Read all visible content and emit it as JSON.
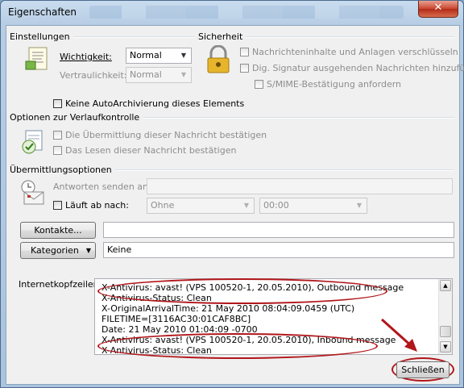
{
  "window": {
    "title": "Eigenschaften",
    "close_glyph": "✕"
  },
  "settings": {
    "heading": "Einstellungen",
    "importance_label": "Wichtigkeit:",
    "importance_value": "Normal",
    "confidentiality_label": "Vertraulichkeit:",
    "confidentiality_value": "Normal",
    "no_autoarchive_label": "Keine AutoArchivierung dieses Elements"
  },
  "security": {
    "heading": "Sicherheit",
    "encrypt_label": "Nachrichteninhalte und Anlagen verschlüsseln",
    "sign_label": "Dig. Signatur ausgehenden Nachrichten hinzufügen",
    "smime_label": "S/MIME-Bestätigung anfordern"
  },
  "tracking": {
    "heading": "Optionen zur Verlaufkontrolle",
    "delivery_label": "Die Übermittlung dieser Nachricht bestätigen",
    "read_label": "Das Lesen dieser Nachricht bestätigen"
  },
  "delivery": {
    "heading": "Übermittlungsoptionen",
    "reply_to_label": "Antworten senden an:",
    "expires_label": "Läuft ab nach:",
    "expires_date": "Ohne",
    "expires_time": "00:00"
  },
  "contacts": {
    "button_label": "Kontakte...",
    "value": ""
  },
  "categories": {
    "button_label": "Kategorien",
    "value": "Keine"
  },
  "internet_headers": {
    "label": "Internetkopfzeilen:",
    "lines": [
      "X-Antivirus: avast! (VPS 100520-1, 20.05.2010), Outbound message",
      "X-Antivirus-Status: Clean",
      "X-OriginalArrivalTime: 21 May 2010 08:04:09.0459 (UTC)",
      "FILETIME=[3116AC30:01CAF8BC]",
      "Date: 21 May 2010 01:04:09 -0700",
      "X-Antivirus: avast! (VPS 100520-1, 20.05.2010), Inbound message",
      "X-Antivirus-Status: Clean"
    ]
  },
  "footer": {
    "close_button": "Schließen"
  },
  "colors": {
    "annotation": "#b1161b",
    "dialog_bg": "#f0f0f0",
    "titlebar": "#c9dcef"
  }
}
